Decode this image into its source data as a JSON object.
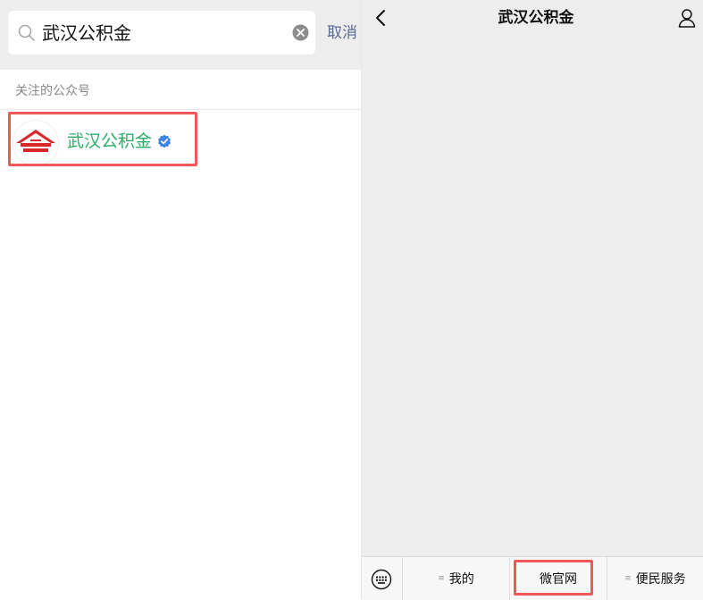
{
  "search": {
    "query": "武汉公积金",
    "cancel_label": "取消"
  },
  "results": {
    "section_title": "关注的公众号",
    "items": [
      {
        "name": "武汉公积金",
        "verified": true
      }
    ]
  },
  "chat": {
    "title": "武汉公积金",
    "menu": [
      {
        "label": "我的",
        "has_submenu": true
      },
      {
        "label": "微官网",
        "has_submenu": false
      },
      {
        "label": "便民服务",
        "has_submenu": true
      }
    ]
  },
  "colors": {
    "accent_green": "#2aae67",
    "link_blue": "#576b95",
    "highlight_red": "#f0585a",
    "verified_blue": "#3d83e6",
    "logo_red": "#d8282a"
  },
  "icons": {
    "search": "search-icon",
    "clear": "clear-icon",
    "verified": "verified-icon",
    "back": "back-icon",
    "profile": "profile-icon",
    "keyboard": "keyboard-icon"
  }
}
